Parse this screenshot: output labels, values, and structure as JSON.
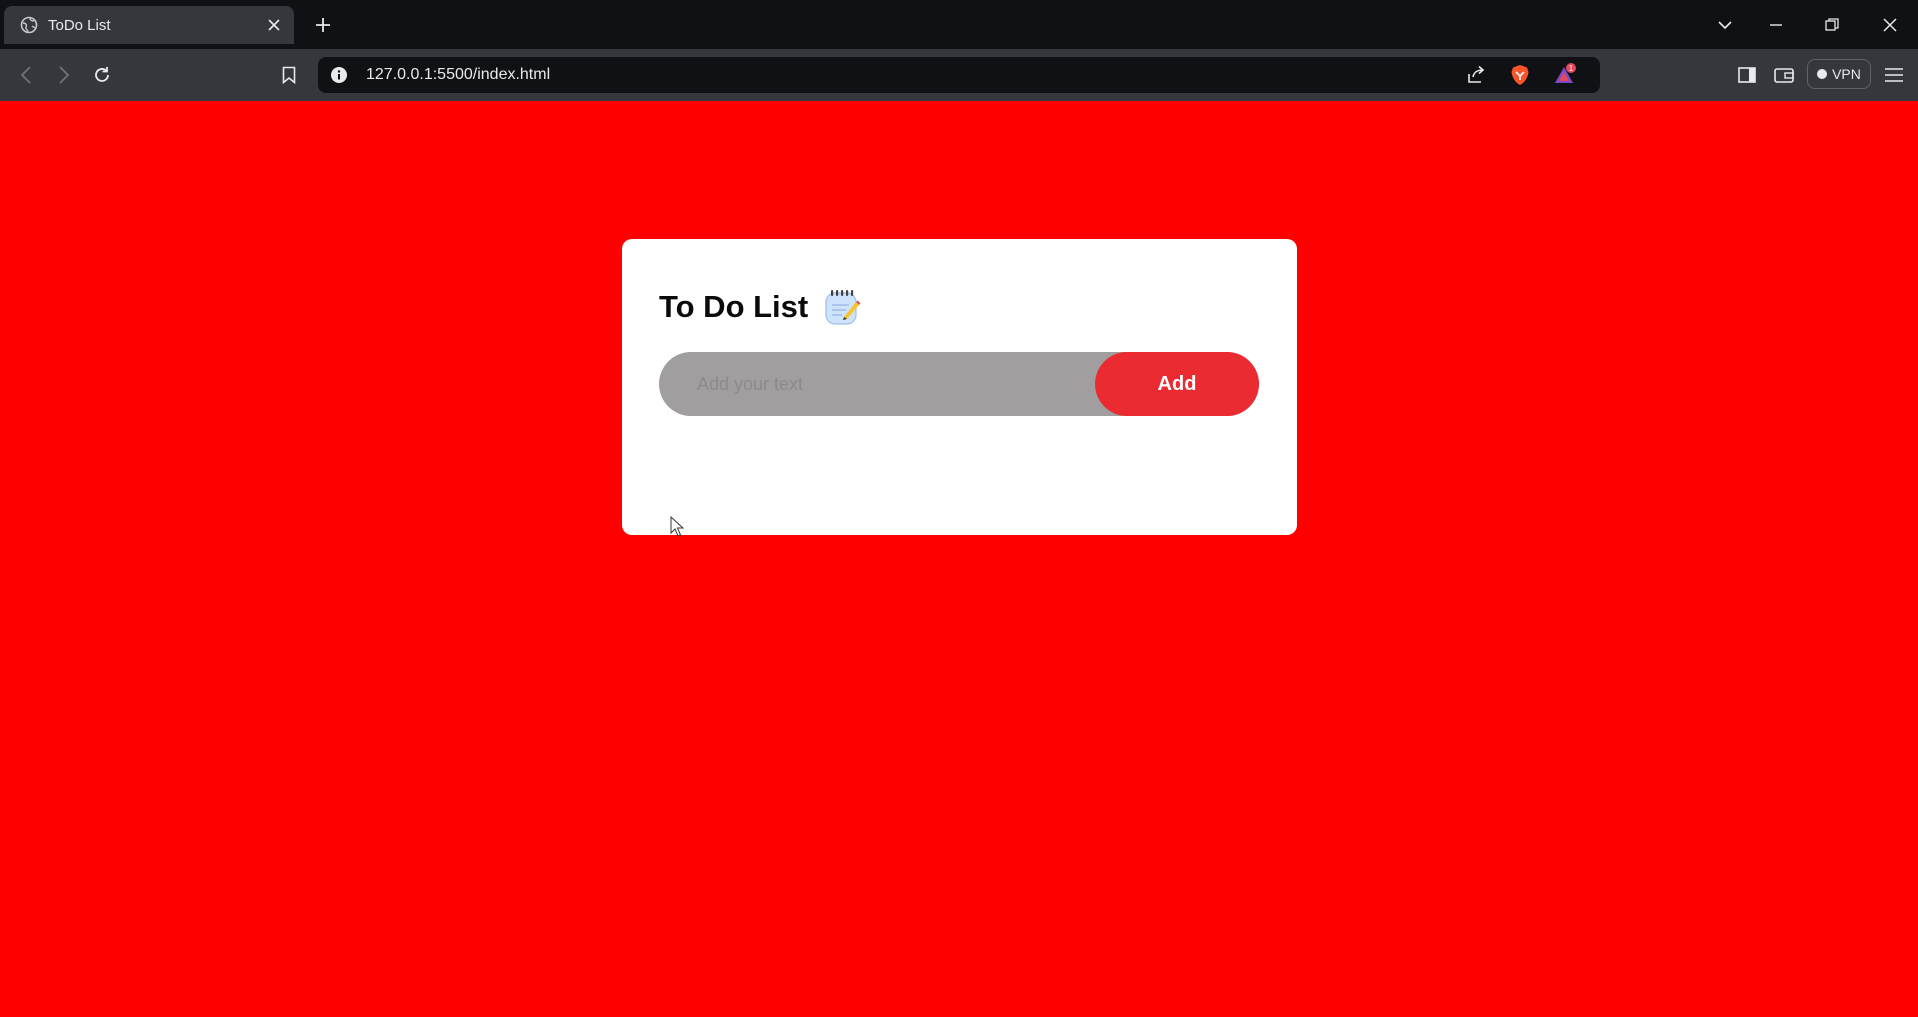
{
  "browser": {
    "tab_title": "ToDo List",
    "url": "127.0.0.1:5500/index.html",
    "vpn_label": "VPN",
    "rewards_badge": "1"
  },
  "app": {
    "title": "To Do List",
    "title_icon": "memo-icon",
    "input_placeholder": "Add your text",
    "input_value": "",
    "add_button_label": "Add",
    "tasks": []
  },
  "colors": {
    "page_background": "#ff0000",
    "card_background": "#ffffff",
    "input_background": "#a19ea0",
    "add_button": "#ea2b31"
  }
}
